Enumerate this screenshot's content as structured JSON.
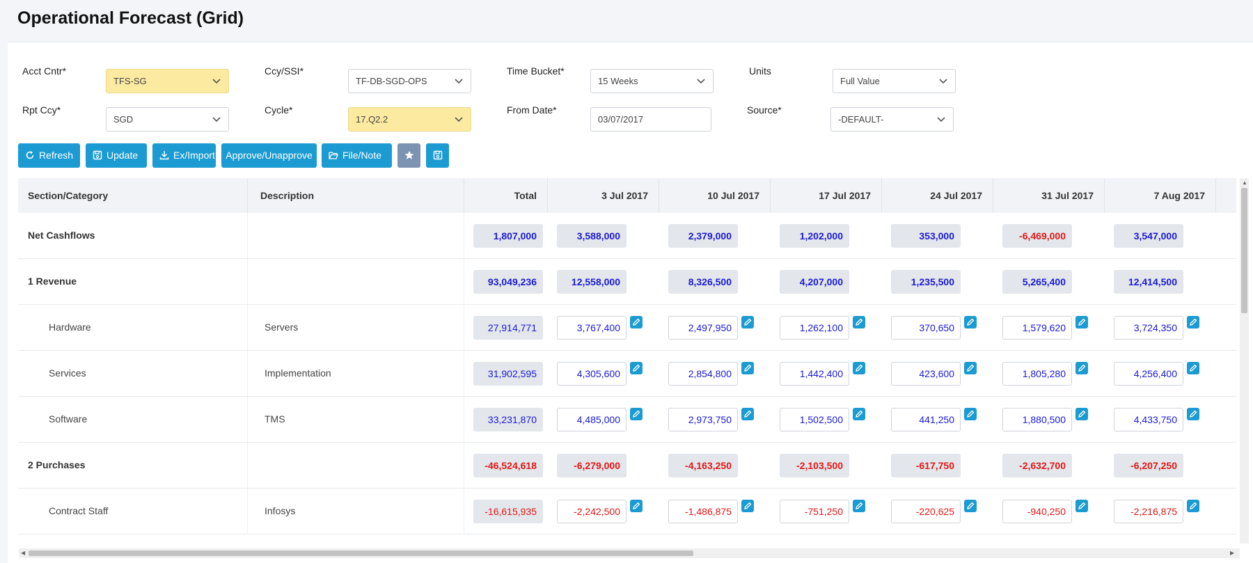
{
  "page": {
    "title": "Operational Forecast (Grid)"
  },
  "filters": {
    "acct_cntr": {
      "label": "Acct Cntr*",
      "value": "TFS-SG"
    },
    "ccy_ssi": {
      "label": "Ccy/SSI*",
      "value": "TF-DB-SGD-OPS"
    },
    "time_bucket": {
      "label": "Time Bucket*",
      "value": "15 Weeks"
    },
    "units": {
      "label": "Units",
      "value": "Full Value"
    },
    "rpt_ccy": {
      "label": "Rpt Ccy*",
      "value": "SGD"
    },
    "cycle": {
      "label": "Cycle*",
      "value": "17.Q2.2"
    },
    "from_date": {
      "label": "From Date*",
      "value": "03/07/2017"
    },
    "source": {
      "label": "Source*",
      "value": "-DEFAULT-"
    }
  },
  "toolbar": {
    "refresh": "Refresh",
    "update": "Update",
    "ex_import": "Ex/Import",
    "approve": "Approve/Unapprove",
    "file_note": "File/Note",
    "star_icon": "star-icon",
    "save_icon": "save-icon"
  },
  "colors": {
    "accent": "#1b9bd1",
    "positive": "#1a1ad6",
    "negative": "#e01818",
    "highlight": "#fdeaa1"
  },
  "grid": {
    "headers": {
      "category": "Section/Category",
      "description": "Description",
      "total": "Total",
      "weeks": [
        "3 Jul 2017",
        "10 Jul 2017",
        "17 Jul 2017",
        "24 Jul 2017",
        "31 Jul 2017",
        "7 Aug 2017"
      ]
    },
    "rows": [
      {
        "category": "Net Cashflows",
        "description": "",
        "total": "1,807,000",
        "values": [
          "3,588,000",
          "2,379,000",
          "1,202,000",
          "353,000",
          "-6,469,000",
          "3,547,000"
        ]
      },
      {
        "category": "1 Revenue",
        "description": "",
        "total": "93,049,236",
        "values": [
          "12,558,000",
          "8,326,500",
          "4,207,000",
          "1,235,500",
          "5,265,400",
          "12,414,500"
        ]
      },
      {
        "category": "Hardware",
        "description": "Servers",
        "total": "27,914,771",
        "values": [
          "3,767,400",
          "2,497,950",
          "1,262,100",
          "370,650",
          "1,579,620",
          "3,724,350"
        ]
      },
      {
        "category": "Services",
        "description": "Implementation",
        "total": "31,902,595",
        "values": [
          "4,305,600",
          "2,854,800",
          "1,442,400",
          "423,600",
          "1,805,280",
          "4,256,400"
        ]
      },
      {
        "category": "Software",
        "description": "TMS",
        "total": "33,231,870",
        "values": [
          "4,485,000",
          "2,973,750",
          "1,502,500",
          "441,250",
          "1,880,500",
          "4,433,750"
        ]
      },
      {
        "category": "2 Purchases",
        "description": "",
        "total": "-46,524,618",
        "values": [
          "-6,279,000",
          "-4,163,250",
          "-2,103,500",
          "-617,750",
          "-2,632,700",
          "-6,207,250"
        ]
      },
      {
        "category": "Contract Staff",
        "description": "Infosys",
        "total": "-16,615,935",
        "values": [
          "-2,242,500",
          "-1,486,875",
          "-751,250",
          "-220,625",
          "-940,250",
          "-2,216,875"
        ]
      }
    ]
  }
}
